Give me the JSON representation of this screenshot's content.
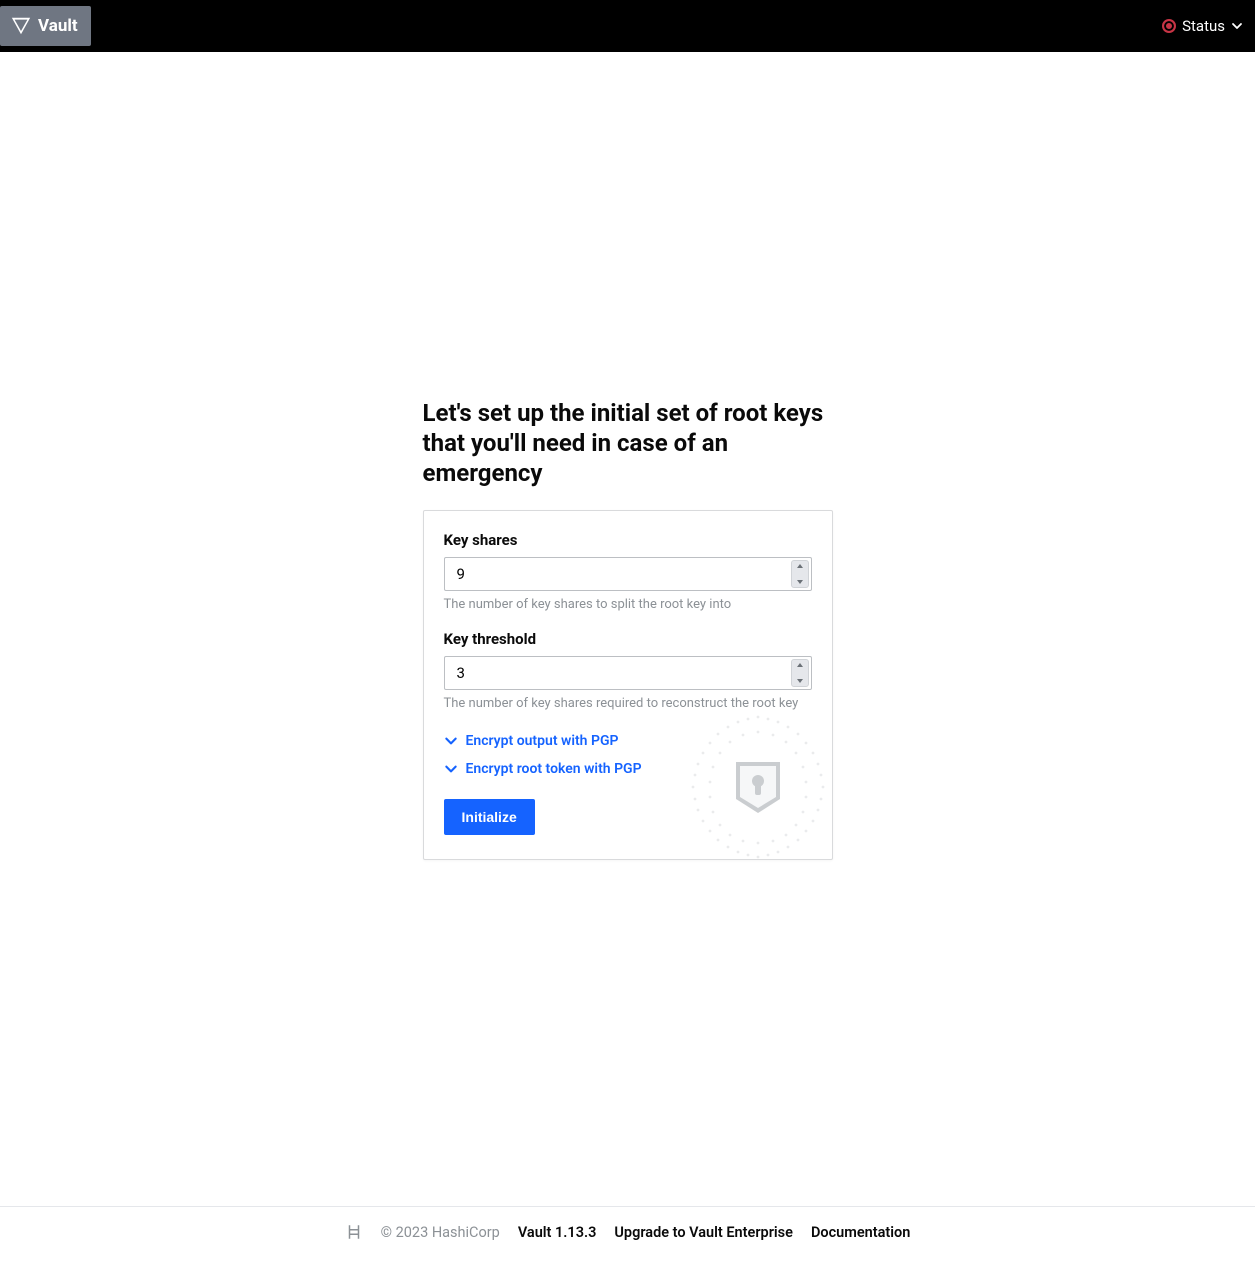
{
  "header": {
    "brand": "Vault",
    "status_label": "Status"
  },
  "main": {
    "title": "Let's set up the initial set of root keys that you'll need in case of an emergency",
    "fields": {
      "key_shares": {
        "label": "Key shares",
        "value": "9",
        "help": "The number of key shares to split the root key into"
      },
      "key_threshold": {
        "label": "Key threshold",
        "value": "3",
        "help": "The number of key shares required to reconstruct the root key"
      }
    },
    "disclosures": {
      "encrypt_output": "Encrypt output with PGP",
      "encrypt_root_token": "Encrypt root token with PGP"
    },
    "actions": {
      "initialize": "Initialize"
    }
  },
  "footer": {
    "copyright": "© 2023 HashiCorp",
    "version": "Vault 1.13.3",
    "upgrade": "Upgrade to Vault Enterprise",
    "documentation": "Documentation"
  }
}
